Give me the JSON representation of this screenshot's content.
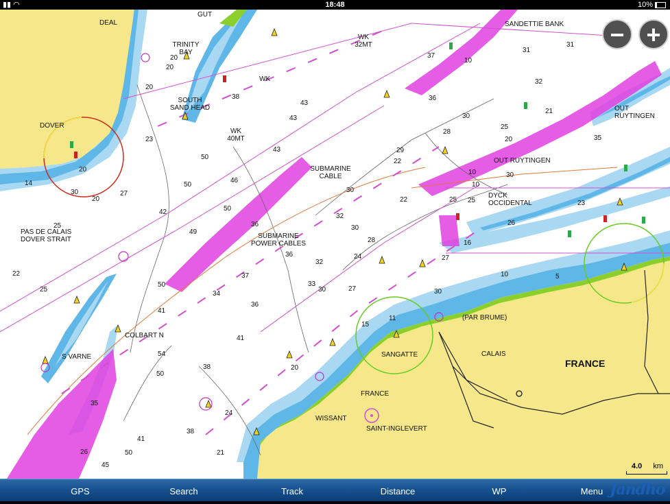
{
  "status_bar": {
    "time": "18:48",
    "battery": "10%"
  },
  "zoom": {
    "out_label": "−",
    "in_label": "+"
  },
  "map_labels": {
    "deal": "DEAL",
    "gut": "GUT",
    "trinity_bay": [
      "TRINITY",
      "BAY"
    ],
    "south_sand_head": [
      "SOUTH",
      "SAND HEAD"
    ],
    "dover": "DOVER",
    "wk_32mt": [
      "WK",
      "32MT"
    ],
    "wk1": "WK",
    "wk_40mt": [
      "WK",
      "40MT"
    ],
    "sandettie_bank": "SANDETTIE BANK",
    "out_ruytingen_ne": [
      "OUT",
      "RUYTINGEN"
    ],
    "out_ruytingen": "OUT RUYTINGEN",
    "submarine_cable": [
      "SUBMARINE",
      "CABLE"
    ],
    "dyck_occidental": [
      "DYCK",
      "OCCIDENTAL"
    ],
    "pas_de_calais": [
      "PAS DE CALAIS",
      "DOVER STRAIT"
    ],
    "submarine_power_cables": [
      "SUBMARINE",
      "POWER CABLES"
    ],
    "colbart_n": "COLBART N",
    "s_varne": "S VARNE",
    "par_brume": "(PAR BRUME)",
    "sangatte": "SANGATTE",
    "calais": "CALAIS",
    "france_big": "FRANCE",
    "france_small": "FRANCE",
    "wissant": "WISSANT",
    "saint_inglevert": "SAINT-INGLEVERT"
  },
  "depths": [
    {
      "v": "20"
    },
    {
      "v": "20"
    },
    {
      "v": "20"
    },
    {
      "v": "38"
    },
    {
      "v": "43"
    },
    {
      "v": "43"
    },
    {
      "v": "43"
    },
    {
      "v": "37"
    },
    {
      "v": "10"
    },
    {
      "v": "36"
    },
    {
      "v": "31"
    },
    {
      "v": "30"
    },
    {
      "v": "32"
    },
    {
      "v": "31"
    },
    {
      "v": "21"
    },
    {
      "v": "25"
    },
    {
      "v": "20"
    },
    {
      "v": "28"
    },
    {
      "v": "22"
    },
    {
      "v": "46"
    },
    {
      "v": "50"
    },
    {
      "v": "50"
    },
    {
      "v": "50"
    },
    {
      "v": "42"
    },
    {
      "v": "27"
    },
    {
      "v": "30"
    },
    {
      "v": "22"
    },
    {
      "v": "25"
    },
    {
      "v": "32"
    },
    {
      "v": "30"
    },
    {
      "v": "36"
    },
    {
      "v": "36"
    },
    {
      "v": "32"
    },
    {
      "v": "33"
    },
    {
      "v": "37"
    },
    {
      "v": "36"
    },
    {
      "v": "34"
    },
    {
      "v": "41"
    },
    {
      "v": "50"
    },
    {
      "v": "27"
    },
    {
      "v": "30"
    },
    {
      "v": "23"
    },
    {
      "v": "25"
    },
    {
      "v": "26"
    },
    {
      "v": "30"
    },
    {
      "v": "10"
    },
    {
      "v": "10"
    },
    {
      "v": "41"
    },
    {
      "v": "54"
    },
    {
      "v": "50"
    },
    {
      "v": "35"
    },
    {
      "v": "41"
    },
    {
      "v": "50"
    },
    {
      "v": "38"
    },
    {
      "v": "26"
    },
    {
      "v": "45"
    },
    {
      "v": "38"
    },
    {
      "v": "24"
    },
    {
      "v": "21"
    },
    {
      "v": "25"
    },
    {
      "v": "22"
    },
    {
      "v": "14"
    },
    {
      "v": "20"
    },
    {
      "v": "30"
    },
    {
      "v": "25"
    },
    {
      "v": "23"
    },
    {
      "v": "20"
    },
    {
      "v": "28"
    },
    {
      "v": "24"
    },
    {
      "v": "30"
    },
    {
      "v": "16"
    },
    {
      "v": "15"
    },
    {
      "v": "11"
    },
    {
      "v": "5"
    },
    {
      "v": "10"
    },
    {
      "v": "20"
    },
    {
      "v": "49"
    },
    {
      "v": "29"
    },
    {
      "v": "35"
    },
    {
      "v": "27"
    }
  ],
  "scale": {
    "value": "4.0",
    "unit": "km"
  },
  "toolbar": {
    "gps": "GPS",
    "search": "Search",
    "track": "Track",
    "distance": "Distance",
    "wp": "WP",
    "menu": "Menu"
  },
  "logo": {
    "text": "Jandho"
  },
  "colors": {
    "land": "#f6e88a",
    "shallow_blue": "#5fb7e8",
    "light_blue": "#a9d8f2",
    "magenta": "#e040e0",
    "green": "#8ccf2d"
  }
}
